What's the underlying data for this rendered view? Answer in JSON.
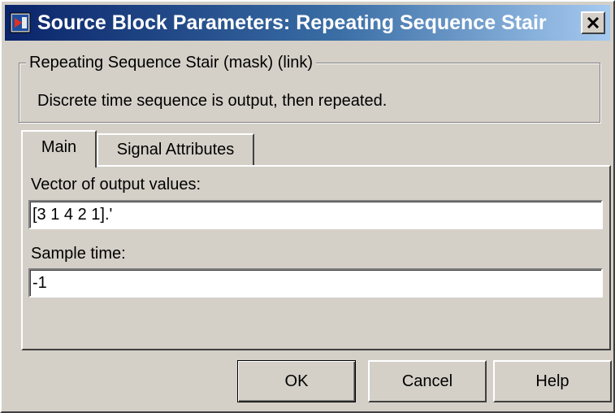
{
  "window": {
    "title": "Source Block Parameters: Repeating Sequence Stair",
    "close_glyph": "✕",
    "title_icon": "simulink-block-icon",
    "close_icon": "close-icon"
  },
  "group": {
    "legend": "Repeating Sequence Stair (mask) (link)",
    "description": "Discrete time sequence is output, then repeated."
  },
  "tabs": [
    {
      "label": "Main",
      "selected": true
    },
    {
      "label": "Signal Attributes",
      "selected": false
    }
  ],
  "fields": {
    "output_values": {
      "label": "Vector of output values:",
      "value": "[3 1 4 2 1].'"
    },
    "sample_time": {
      "label": "Sample time:",
      "value": "-1"
    }
  },
  "buttons": {
    "ok": "OK",
    "cancel": "Cancel",
    "help": "Help"
  },
  "colors": {
    "title_gradient_start": "#0a246a",
    "title_gradient_end": "#a6caf0",
    "dialog_face": "#d4d0c8"
  }
}
